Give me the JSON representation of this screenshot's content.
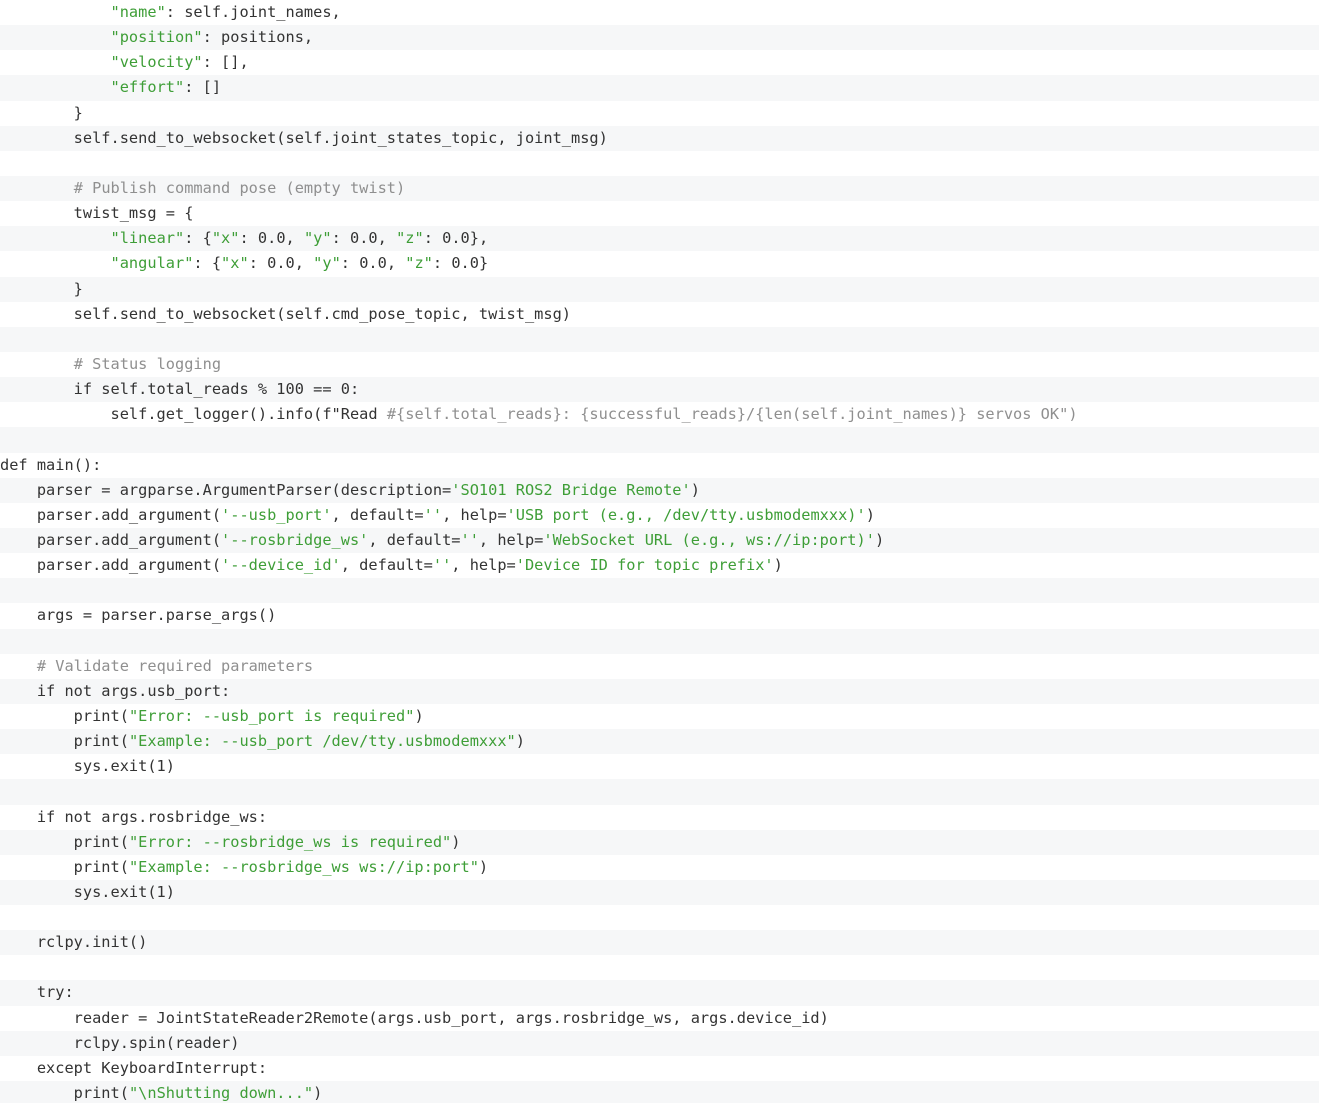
{
  "code": {
    "lines": [
      [
        {
          "t": "            "
        },
        {
          "t": "\"name\"",
          "c": "str"
        },
        {
          "t": ": self.joint_names,"
        }
      ],
      [
        {
          "t": "            "
        },
        {
          "t": "\"position\"",
          "c": "str"
        },
        {
          "t": ": positions,"
        }
      ],
      [
        {
          "t": "            "
        },
        {
          "t": "\"velocity\"",
          "c": "str"
        },
        {
          "t": ": [],"
        }
      ],
      [
        {
          "t": "            "
        },
        {
          "t": "\"effort\"",
          "c": "str"
        },
        {
          "t": ": []"
        }
      ],
      [
        {
          "t": "        }"
        }
      ],
      [
        {
          "t": "        self.send_to_websocket(self.joint_states_topic, joint_msg)"
        }
      ],
      [
        {
          "t": ""
        }
      ],
      [
        {
          "t": "        "
        },
        {
          "t": "# Publish command pose (empty twist)",
          "c": "com"
        }
      ],
      [
        {
          "t": "        twist_msg = {"
        }
      ],
      [
        {
          "t": "            "
        },
        {
          "t": "\"linear\"",
          "c": "str"
        },
        {
          "t": ": {"
        },
        {
          "t": "\"x\"",
          "c": "str"
        },
        {
          "t": ": 0.0, "
        },
        {
          "t": "\"y\"",
          "c": "str"
        },
        {
          "t": ": 0.0, "
        },
        {
          "t": "\"z\"",
          "c": "str"
        },
        {
          "t": ": 0.0},"
        }
      ],
      [
        {
          "t": "            "
        },
        {
          "t": "\"angular\"",
          "c": "str"
        },
        {
          "t": ": {"
        },
        {
          "t": "\"x\"",
          "c": "str"
        },
        {
          "t": ": 0.0, "
        },
        {
          "t": "\"y\"",
          "c": "str"
        },
        {
          "t": ": 0.0, "
        },
        {
          "t": "\"z\"",
          "c": "str"
        },
        {
          "t": ": 0.0}"
        }
      ],
      [
        {
          "t": "        }"
        }
      ],
      [
        {
          "t": "        self.send_to_websocket(self.cmd_pose_topic, twist_msg)"
        }
      ],
      [
        {
          "t": ""
        }
      ],
      [
        {
          "t": "        "
        },
        {
          "t": "# Status logging",
          "c": "com"
        }
      ],
      [
        {
          "t": "        if self.total_reads % 100 == 0:"
        }
      ],
      [
        {
          "t": "            self.get_logger().info(f\"Read "
        },
        {
          "t": "#{self.total_reads}: {successful_reads}/{len(self.joint_names)} servos OK\")",
          "c": "com"
        }
      ],
      [
        {
          "t": ""
        }
      ],
      [
        {
          "t": "def main():"
        }
      ],
      [
        {
          "t": "    parser = argparse.ArgumentParser(description="
        },
        {
          "t": "'SO101 ROS2 Bridge Remote'",
          "c": "str"
        },
        {
          "t": ")"
        }
      ],
      [
        {
          "t": "    parser.add_argument("
        },
        {
          "t": "'--usb_port'",
          "c": "str"
        },
        {
          "t": ", default="
        },
        {
          "t": "''",
          "c": "str"
        },
        {
          "t": ", help="
        },
        {
          "t": "'USB port (e.g., /dev/tty.usbmodemxxx)'",
          "c": "str"
        },
        {
          "t": ")"
        }
      ],
      [
        {
          "t": "    parser.add_argument("
        },
        {
          "t": "'--rosbridge_ws'",
          "c": "str"
        },
        {
          "t": ", default="
        },
        {
          "t": "''",
          "c": "str"
        },
        {
          "t": ", help="
        },
        {
          "t": "'WebSocket URL (e.g., ws://ip:port)'",
          "c": "str"
        },
        {
          "t": ")"
        }
      ],
      [
        {
          "t": "    parser.add_argument("
        },
        {
          "t": "'--device_id'",
          "c": "str"
        },
        {
          "t": ", default="
        },
        {
          "t": "''",
          "c": "str"
        },
        {
          "t": ", help="
        },
        {
          "t": "'Device ID for topic prefix'",
          "c": "str"
        },
        {
          "t": ")"
        }
      ],
      [
        {
          "t": ""
        }
      ],
      [
        {
          "t": "    args = parser.parse_args()"
        }
      ],
      [
        {
          "t": ""
        }
      ],
      [
        {
          "t": "    "
        },
        {
          "t": "# Validate required parameters",
          "c": "com"
        }
      ],
      [
        {
          "t": "    if not args.usb_port:"
        }
      ],
      [
        {
          "t": "        print("
        },
        {
          "t": "\"Error: --usb_port is required\"",
          "c": "str"
        },
        {
          "t": ")"
        }
      ],
      [
        {
          "t": "        print("
        },
        {
          "t": "\"Example: --usb_port /dev/tty.usbmodemxxx\"",
          "c": "str"
        },
        {
          "t": ")"
        }
      ],
      [
        {
          "t": "        sys.exit(1)"
        }
      ],
      [
        {
          "t": ""
        }
      ],
      [
        {
          "t": "    if not args.rosbridge_ws:"
        }
      ],
      [
        {
          "t": "        print("
        },
        {
          "t": "\"Error: --rosbridge_ws is required\"",
          "c": "str"
        },
        {
          "t": ")"
        }
      ],
      [
        {
          "t": "        print("
        },
        {
          "t": "\"Example: --rosbridge_ws ws://ip:port\"",
          "c": "str"
        },
        {
          "t": ")"
        }
      ],
      [
        {
          "t": "        sys.exit(1)"
        }
      ],
      [
        {
          "t": ""
        }
      ],
      [
        {
          "t": "    rclpy.init()"
        }
      ],
      [
        {
          "t": ""
        }
      ],
      [
        {
          "t": "    try:"
        }
      ],
      [
        {
          "t": "        reader = JointStateReader2Remote(args.usb_port, args.rosbridge_ws, args.device_id)"
        }
      ],
      [
        {
          "t": "        rclpy.spin(reader)"
        }
      ],
      [
        {
          "t": "    except KeyboardInterrupt:"
        }
      ],
      [
        {
          "t": "        print("
        },
        {
          "t": "\"\\nShutting down...\"",
          "c": "str"
        },
        {
          "t": ")"
        }
      ]
    ]
  }
}
